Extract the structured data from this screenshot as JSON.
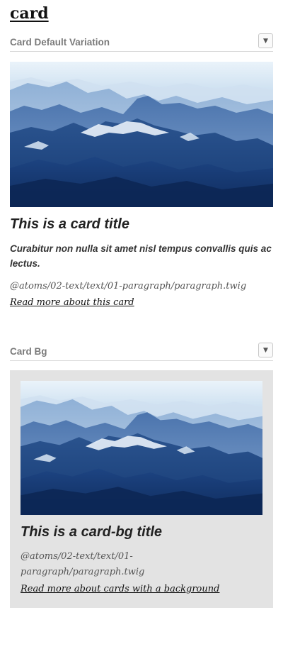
{
  "page": {
    "title": "card"
  },
  "sections": {
    "default": {
      "header": "Card Default Variation",
      "toggle": "▼",
      "image_icon": "mountain-landscape-image",
      "title": "This is a card title",
      "subtitle": "Curabitur non nulla sit amet nisl tempus convallis quis ac lectus.",
      "body": "@atoms/02-text/text/01-paragraph/paragraph.twig",
      "link": "Read more about this card"
    },
    "bg": {
      "header": "Card Bg",
      "toggle": "▼",
      "image_icon": "mountain-landscape-image",
      "title": "This is a card-bg title",
      "body": "@atoms/02-text/text/01-paragraph/paragraph.twig",
      "link": "Read more about cards with a background"
    }
  },
  "colors": {
    "panel_bg": "#e3e3e3",
    "header_text": "#7a7a7a",
    "image_sky": "#e6f0f8",
    "image_mountain_dark": "#1c3f7a"
  }
}
